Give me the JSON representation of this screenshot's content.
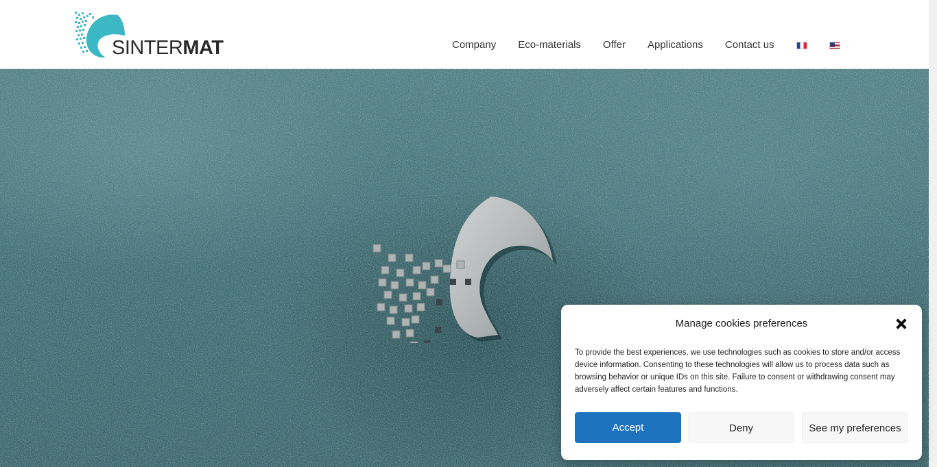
{
  "brand": {
    "logo_light": "SINTER",
    "logo_bold": "MAT",
    "accent": "#3cb8c4",
    "text_color": "#2a2a2a"
  },
  "nav": {
    "items": [
      {
        "label": "Company"
      },
      {
        "label": "Eco-materials"
      },
      {
        "label": "Offer"
      },
      {
        "label": "Applications"
      },
      {
        "label": "Contact us"
      }
    ],
    "languages": [
      {
        "icon": "flag-fr-icon"
      },
      {
        "icon": "flag-us-icon"
      }
    ]
  },
  "hero": {
    "background_color": "#3f6c73",
    "emblem_icon": "sintermat-emblem-icon"
  },
  "cookie_dialog": {
    "title": "Manage cookies preferences",
    "body": "To provide the best experiences, we use technologies such as cookies to store and/or access device information. Consenting to these technologies will allow us to process data such as browsing behavior or unique IDs on this site. Failure to consent or withdrawing consent may adversely affect certain features and functions.",
    "accept_label": "Accept",
    "deny_label": "Deny",
    "preferences_label": "See my preferences",
    "accept_color": "#1e73be",
    "close_icon": "close-icon"
  }
}
